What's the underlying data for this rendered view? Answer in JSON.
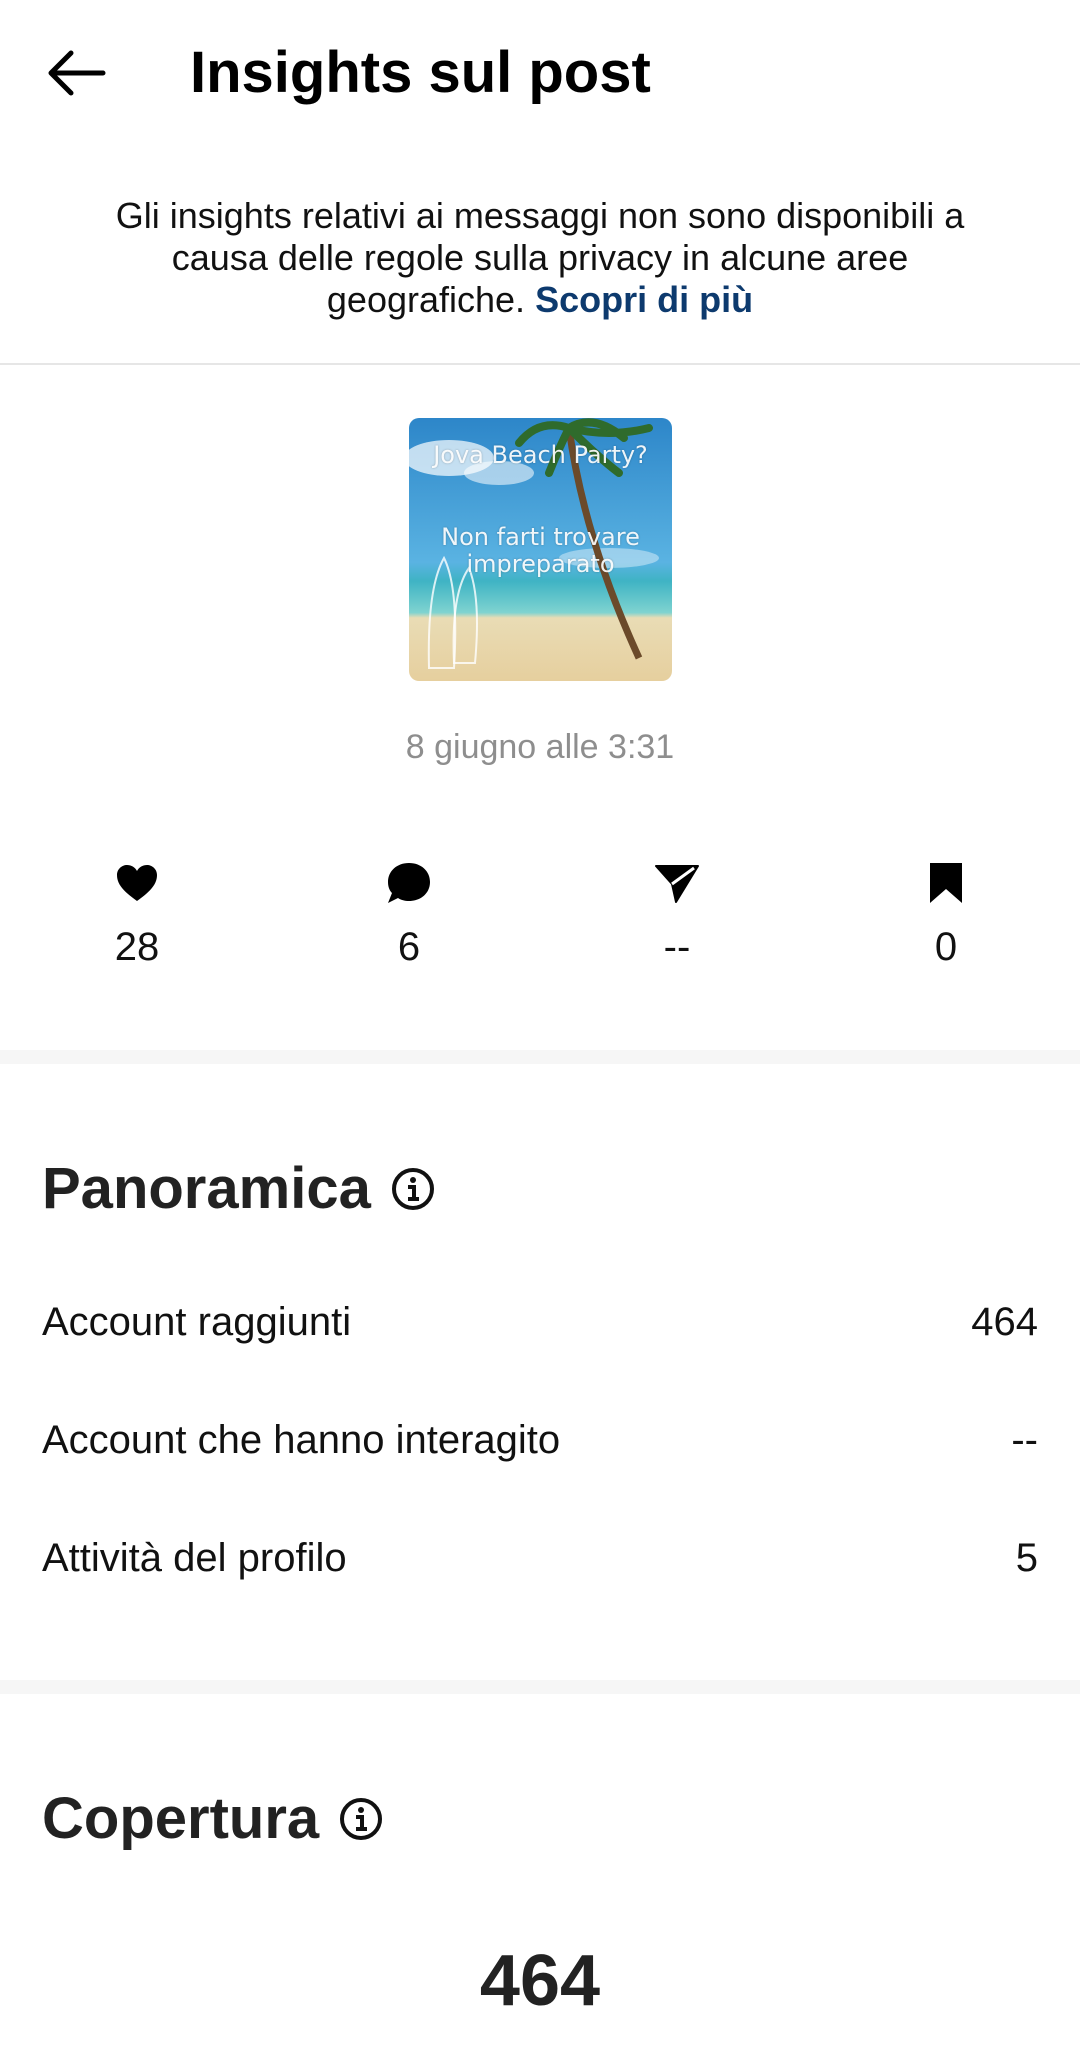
{
  "header": {
    "title": "Insights sul post",
    "back_icon": "arrow-left-icon"
  },
  "notice": {
    "text": "Gli insights relativi ai messaggi non sono disponibili a causa delle regole sulla privacy in alcune aree geografiche.",
    "link": "Scopri di più"
  },
  "post": {
    "thumbnail_text_1": "Jova Beach Party?",
    "thumbnail_text_2": "Non farti trovare impreparato",
    "date": "8 giugno alle 3:31"
  },
  "stats": [
    {
      "icon": "heart-icon",
      "value": "28"
    },
    {
      "icon": "comment-icon",
      "value": "6"
    },
    {
      "icon": "share-icon",
      "value": "--"
    },
    {
      "icon": "bookmark-icon",
      "value": "0"
    }
  ],
  "overview": {
    "title": "Panoramica",
    "rows": [
      {
        "label": "Account raggiunti",
        "value": "464"
      },
      {
        "label": "Account che hanno interagito",
        "value": "--"
      },
      {
        "label": "Attività del profilo",
        "value": "5"
      }
    ]
  },
  "reach": {
    "title": "Copertura",
    "value": "464"
  },
  "colors": {
    "link": "#0d3a6e",
    "muted": "#8e8e8e",
    "divider": "#e6e6e6"
  }
}
